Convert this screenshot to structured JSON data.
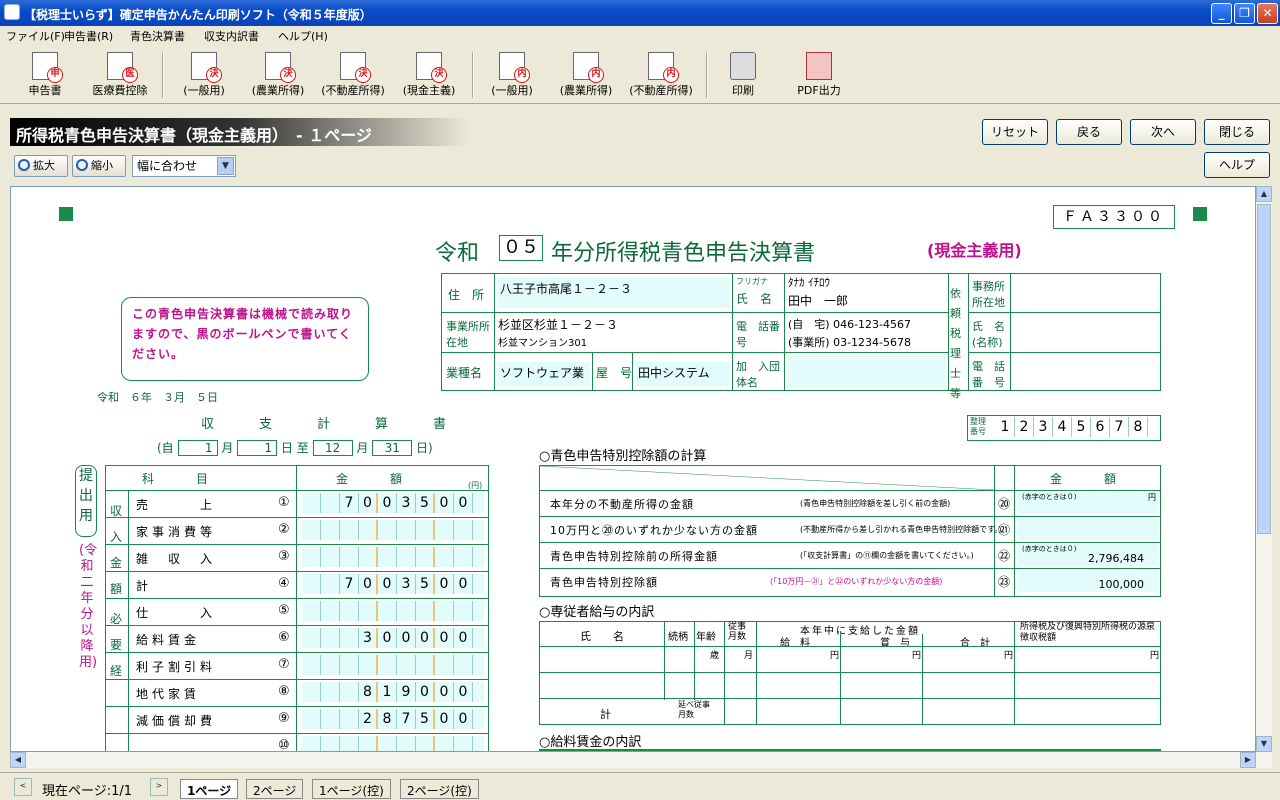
{
  "window": {
    "title": "【税理士いらず】確定申告かんたん印刷ソフト（令和５年度版）"
  },
  "menu": [
    "ファイル(F)",
    "申告書(R)",
    "青色決算書",
    "収支内訳書",
    "ヘルプ(H)"
  ],
  "toolbar": [
    {
      "label": "申告書",
      "stamp": "申",
      "icon": "shinkoku-icon"
    },
    {
      "label": "医療費控除",
      "stamp": "医",
      "icon": "iryouhi-icon"
    },
    {
      "label": "(一般用)",
      "stamp": "決",
      "icon": "kessan-ippan-icon"
    },
    {
      "label": "(農業所得)",
      "stamp": "決",
      "icon": "kessan-nougyou-icon"
    },
    {
      "label": "(不動産所得)",
      "stamp": "決",
      "icon": "kessan-fudousan-icon"
    },
    {
      "label": "(現金主義)",
      "stamp": "決",
      "icon": "kessan-genkin-icon"
    },
    {
      "label": "(一般用)",
      "stamp": "内",
      "icon": "uchiwake-ippan-icon"
    },
    {
      "label": "(農業所得)",
      "stamp": "内",
      "icon": "uchiwake-nougyou-icon"
    },
    {
      "label": "(不動産所得)",
      "stamp": "内",
      "icon": "uchiwake-fudousan-icon"
    },
    {
      "label": "印刷",
      "icon": "printer-icon"
    },
    {
      "label": "PDF出力",
      "icon": "pdf-icon"
    }
  ],
  "header": {
    "title": "所得税青色申告決算書（現金主義用）　- １ページ"
  },
  "buttons": {
    "reset": "リセット",
    "back": "戻る",
    "next": "次へ",
    "close": "閉じる",
    "help": "ヘルプ"
  },
  "zoom": {
    "in": "拡大",
    "out": "縮小",
    "fit": "幅に合わせ"
  },
  "form": {
    "code": "ＦＡ３３００",
    "title_prefix": "令和",
    "year": "０５",
    "title_main": "年分所得税青色申告決算書",
    "title_sub": "(現金主義用)",
    "notice": "この青色申告決算書は機械で読み取りますので、黒のボールペンで書いてください。",
    "date": "令和　６年　３月　５日",
    "addr_label": "住　所",
    "addr": "八王子市高尾１－２－３",
    "furigana_label": "フリガナ",
    "furigana": "ﾀﾅｶ ｲﾁﾛｳ",
    "name_label": "氏　名",
    "name": "田中　一郎",
    "office_label": "事業所所在地",
    "office": "杉並区杉並１－２－３",
    "office2": "杉並マンション301",
    "tel_label": "電　話番　号",
    "tel_home": "(自　宅) 046-123-4567",
    "tel_office": "(事業所) 03-1234-5678",
    "biz_label": "業種名",
    "biz": "ソフトウェア業",
    "shop_label": "屋　号",
    "shop": "田中システム",
    "assoc_label": "加　入団体名",
    "tax_label": "依頼税理士等",
    "tax_office": "事務所所在地",
    "tax_name": "氏　名(名称)",
    "tax_tel": "電　話番　号",
    "seiri_label": "整理番号",
    "seiri": "12345678",
    "income_title": "収　支　計　算　書",
    "period": {
      "from_m": "1",
      "from_d": "1",
      "to_m": "12",
      "to_d": "31"
    },
    "left_headers": {
      "item": "科　　目",
      "amount": "金　　額",
      "unit": "(円)"
    },
    "side_label": "提出用",
    "side_label2": "(令和二年分以降用)",
    "rows": [
      {
        "sec": "収入金額",
        "label": "売　　　上",
        "num": "①",
        "value": "7003500"
      },
      {
        "sec": "",
        "label": "家事消費等",
        "num": "②",
        "value": ""
      },
      {
        "sec": "",
        "label": "雑　収　入",
        "num": "③",
        "value": ""
      },
      {
        "sec": "",
        "label": "計",
        "num": "④",
        "value": "7003500"
      },
      {
        "sec": "必要経",
        "label": "仕　　　入",
        "num": "⑤",
        "value": ""
      },
      {
        "sec": "",
        "label": "給料賃金",
        "num": "⑥",
        "value": "300000"
      },
      {
        "sec": "",
        "label": "利子割引料",
        "num": "⑦",
        "value": ""
      },
      {
        "sec": "",
        "label": "地代家賃",
        "num": "⑧",
        "value": "819000"
      },
      {
        "sec": "",
        "label": "減価償却費",
        "num": "⑨",
        "value": "287500"
      },
      {
        "sec": "",
        "label": "",
        "num": "⑩",
        "value": ""
      }
    ],
    "blue_title": "○青色申告特別控除額の計算",
    "blue_amount_header": "金　　額",
    "blue_rows": [
      {
        "label": "本年分の不動産所得の金額",
        "note": "(青色申告特別控除額を差し引く前の金額)",
        "num": "⑳",
        "value": "",
        "hint": "(赤字のときは０)",
        "unit": "円"
      },
      {
        "label": "10万円と⑳のいずれか少ない方の金額",
        "note": "(不動産所得から差し引かれる青色申告特別控除額です。)",
        "num": "㉑",
        "value": "",
        "hint": "",
        "unit": ""
      },
      {
        "label": "青色申告特別控除前の所得金額",
        "note": "(「収支計算書」の⑪欄の金額を書いてください。)",
        "num": "㉒",
        "value": "2,796,484",
        "hint": "(赤字のときは０)",
        "unit": ""
      },
      {
        "label": "青色申告特別控除額",
        "note": "(「10万円－㉑」と㉒のいずれか少ない方の金額)",
        "num": "㉓",
        "value": "100,000",
        "hint": "",
        "unit": ""
      }
    ],
    "emp_title": "○専従者給与の内訳",
    "emp_headers": {
      "name": "氏　　名",
      "rel": "続柄",
      "age": "年齢",
      "months": "従事月数",
      "paid": "本年中に支給した金額",
      "salary": "給　料",
      "bonus": "賞　与",
      "total": "合　計",
      "tax": "所得税及び復興特別所得税の源泉徴収税額",
      "sai": "歳",
      "getsu": "月",
      "yen": "円",
      "sum": "計",
      "months2": "延べ従事月数"
    },
    "wage_title": "○給料賃金の内訳"
  },
  "status": {
    "page": "現在ページ:1/1",
    "tabs": [
      "1ページ",
      "2ページ",
      "1ページ(控)",
      "2ページ(控)"
    ]
  }
}
